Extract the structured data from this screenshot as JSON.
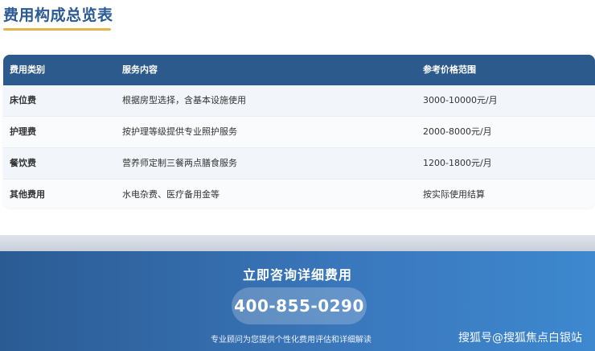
{
  "page": {
    "title": "费用构成总览表"
  },
  "table": {
    "headers": [
      "费用类别",
      "服务内容",
      "参考价格范围"
    ],
    "rows": [
      {
        "category": "床位费",
        "content": "根据房型选择，含基本设施使用",
        "price": "3000-10000元/月"
      },
      {
        "category": "护理费",
        "content": "按护理等级提供专业照护服务",
        "price": "2000-8000元/月"
      },
      {
        "category": "餐饮费",
        "content": "营养师定制三餐两点膳食服务",
        "price": "1200-1800元/月"
      },
      {
        "category": "其他费用",
        "content": "水电杂费、医疗备用金等",
        "price": "按实际使用结算"
      }
    ]
  },
  "cta": {
    "title": "立即咨询详细费用",
    "phone": "400-855-0290",
    "subtitle": "专业顾问为您提供个性化费用评估和详细解读"
  },
  "watermark": "搜狐号@搜狐焦点白银站",
  "colors": {
    "title": "#2c5a93",
    "underline": "#e6b24b",
    "header_bg": "#2d5a8c",
    "cta_start": "#2b5b93",
    "cta_end": "#3d88cf"
  }
}
